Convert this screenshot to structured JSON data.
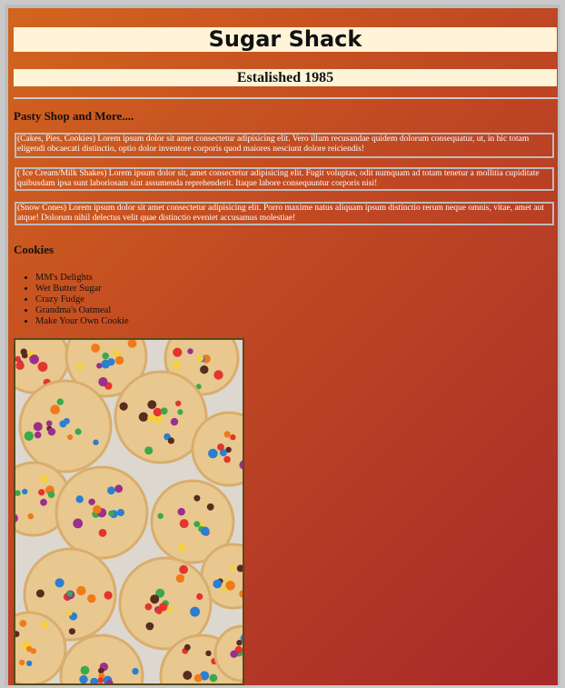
{
  "site": {
    "title": "Sugar Shack",
    "established": "Estalished 1985"
  },
  "intro": {
    "heading": "Pasty Shop and More...."
  },
  "sections": [
    {
      "text": "(Cakes, Pies, Cookies) Lorem ipsum dolor sit amet consectetur adipisicing elit. Vero illum recusandae quidem dolorum consequatur, ut, in hic totam eligendi obcaecati distinctio, optio dolor inventore corporis quod maiores nesciunt dolore reiciendis!"
    },
    {
      "text": "( Ice Cream/Milk Shakes) Lorem ipsum dolor sit, amet consectetur adipisicing elit. Fugit voluptas, odit numquam ad totam tenetur a mollitia cupiditate quibusdam ipsa sunt laboriosam sint assumenda reprehenderit. Itaque labore consequuntur corporis nisi!"
    },
    {
      "text": "(Snow Cones) Lorem ipsum dolor sit amet consectetur adipisicing elit. Porro maxime natus aliquam ipsum distinctio rerum neque omnis, vitae, amet aut atque! Dolorum nihil delectus velit quae distinctio eveniet accusamus molestiae!"
    }
  ],
  "cookies": {
    "heading": "Cookies",
    "items": [
      "MM's Delights",
      "Wet Butter Sugar",
      "Crazy Fudge",
      "Grandma's Oatmeal",
      "Make Your Own Cookie"
    ]
  },
  "image": {
    "subject": "cookies-photo",
    "colors": [
      "#e8c88f",
      "#d9ad6d",
      "#2b7fd0",
      "#e3342f",
      "#3aa84b",
      "#f4d03f",
      "#f07a1a",
      "#5a2b1e",
      "#9a2f8c"
    ]
  }
}
